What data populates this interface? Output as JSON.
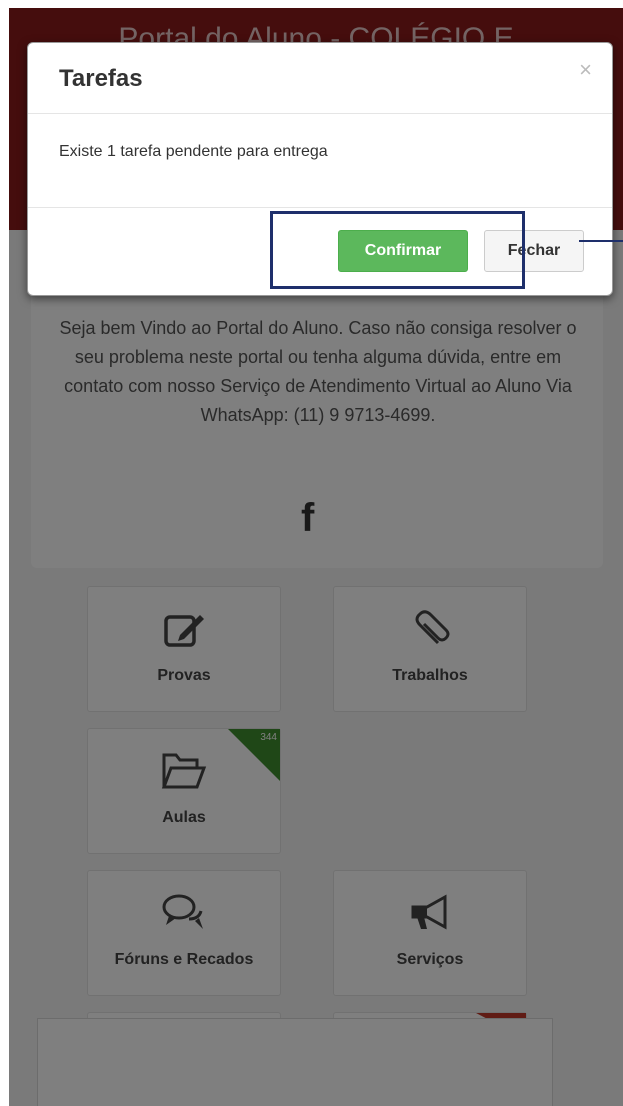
{
  "header": {
    "title": "Portal do Aluno - COLÉGIO E"
  },
  "welcome": {
    "text": "Seja bem Vindo ao Portal do Aluno. Caso não consiga resolver o seu problema neste portal ou tenha alguma dúvida, entre em contato com nosso Serviço de Atendimento Virtual ao Aluno Via WhatsApp: (11) 9 9713-4699."
  },
  "social": {
    "icon": "facebook-icon",
    "glyph": "f"
  },
  "tiles": [
    {
      "label": "Provas",
      "icon": "edit-icon"
    },
    {
      "label": "Trabalhos",
      "icon": "paperclip-icon"
    },
    {
      "label": "Aulas",
      "icon": "folder-open-icon",
      "badge": "344"
    },
    {
      "label": "Fóruns e Recados",
      "icon": "comments-icon"
    },
    {
      "label": "Serviços",
      "icon": "bullhorn-icon"
    }
  ],
  "modal": {
    "title": "Tarefas",
    "close_glyph": "×",
    "message": "Existe 1 tarefa pendente para entrega",
    "confirm_label": "Confirmar",
    "close_label": "Fechar"
  },
  "colors": {
    "header_bg": "#8b1a1a",
    "confirm_bg": "#5cb85c",
    "badge_bg": "#3e8e2e",
    "highlight": "#1e2f6b"
  }
}
